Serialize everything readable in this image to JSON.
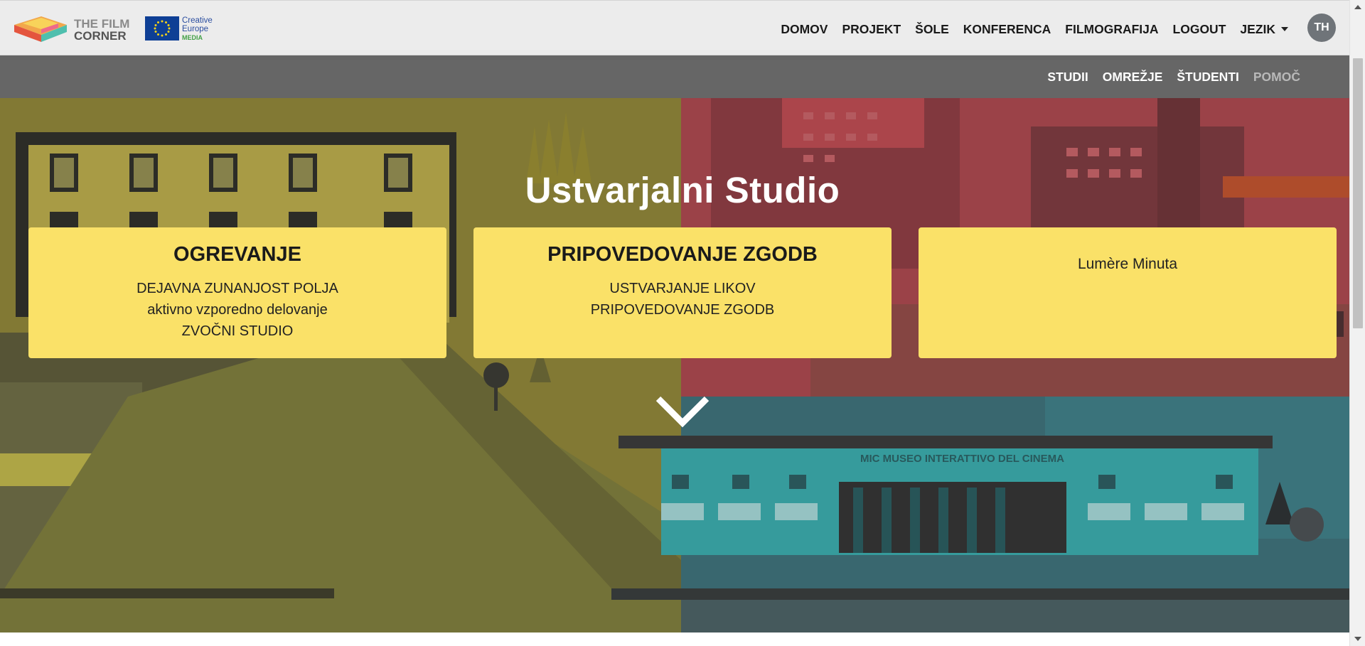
{
  "brand": {
    "logo_line1": "THE FILM",
    "logo_line2": "CORNER",
    "eu_line1": "Creative",
    "eu_line2": "Europe",
    "eu_line3": "MEDIA"
  },
  "main_nav": {
    "items": [
      "DOMOV",
      "PROJEKT",
      "ŠOLE",
      "KONFERENCA",
      "FILMOGRAFIJA",
      "LOGOUT",
      "JEZIK"
    ],
    "user_initials": "TH"
  },
  "sub_nav": {
    "items": [
      "STUDII",
      "OMREŽJE",
      "ŠTUDENTI",
      "POMOČ"
    ],
    "active_muted": "POMOČ"
  },
  "hero": {
    "title": "Ustvarjalni Studio",
    "cards": [
      {
        "title": "OGREVANJE",
        "lines": [
          "DEJAVNA ZUNANJOST POLJA",
          "aktivno vzporedno delovanje",
          "ZVOČNI STUDIO"
        ]
      },
      {
        "title": "PRIPOVEDOVANJE ZGODB",
        "lines": [
          "USTVARJANJE LIKOV",
          "PRIPOVEDOVANJE ZGODB"
        ]
      },
      {
        "title": "",
        "text": "Lumère Minuta"
      }
    ],
    "building_sign": "MIC MUSEO INTERATTIVO DEL CINEMA"
  },
  "colors": {
    "accent_yellow": "#fae168",
    "subnav_bg": "#666666",
    "topbar_bg": "#ececec"
  },
  "icons": [
    "film-corner-logo-icon",
    "eu-flag-icon",
    "caret-down-icon",
    "chevron-down-icon",
    "scroll-up-icon",
    "scroll-down-icon"
  ]
}
